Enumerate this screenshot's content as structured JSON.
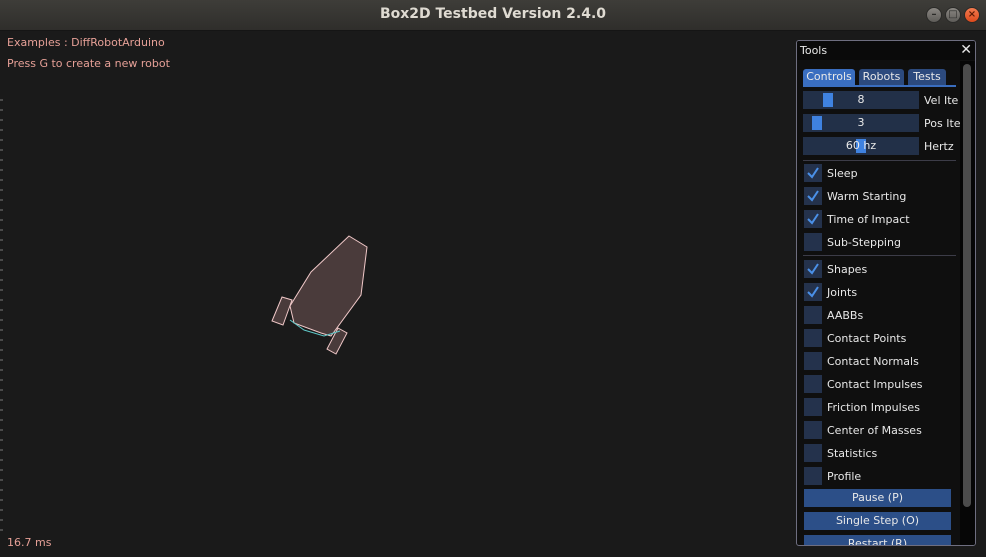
{
  "window": {
    "title": "Box2D Testbed Version 2.4.0"
  },
  "overlay": {
    "example_line": "Examples : DiffRobotArduino",
    "hint_line": "Press G to create a new robot",
    "frame_time": "16.7 ms"
  },
  "tools": {
    "title": "Tools",
    "tabs": [
      {
        "label": "Controls",
        "active": true
      },
      {
        "label": "Robots",
        "active": false
      },
      {
        "label": "Tests",
        "active": false
      }
    ],
    "sliders": [
      {
        "value": "8",
        "label": "Vel Ite",
        "fraction": 0.11
      },
      {
        "value": "3",
        "label": "Pos Ite",
        "fraction": 0.05
      },
      {
        "value": "60 hz",
        "label": "Hertz",
        "fraction": 0.5
      }
    ],
    "checkboxes_group1": [
      {
        "label": "Sleep",
        "checked": true
      },
      {
        "label": "Warm Starting",
        "checked": true
      },
      {
        "label": "Time of Impact",
        "checked": true
      },
      {
        "label": "Sub-Stepping",
        "checked": false
      }
    ],
    "checkboxes_group2": [
      {
        "label": "Shapes",
        "checked": true
      },
      {
        "label": "Joints",
        "checked": true
      },
      {
        "label": "AABBs",
        "checked": false
      },
      {
        "label": "Contact Points",
        "checked": false
      },
      {
        "label": "Contact Normals",
        "checked": false
      },
      {
        "label": "Contact Impulses",
        "checked": false
      },
      {
        "label": "Friction Impulses",
        "checked": false
      },
      {
        "label": "Center of Masses",
        "checked": false
      },
      {
        "label": "Statistics",
        "checked": false
      },
      {
        "label": "Profile",
        "checked": false
      }
    ],
    "buttons": [
      {
        "label": "Pause (P)"
      },
      {
        "label": "Single Step (O)"
      },
      {
        "label": "Restart (R)"
      }
    ]
  },
  "colors": {
    "overlay_text": "#e6a097",
    "body_fill": "#4a3b3b",
    "body_outline": "#f0c8c8",
    "accent": "#3f82e0"
  }
}
